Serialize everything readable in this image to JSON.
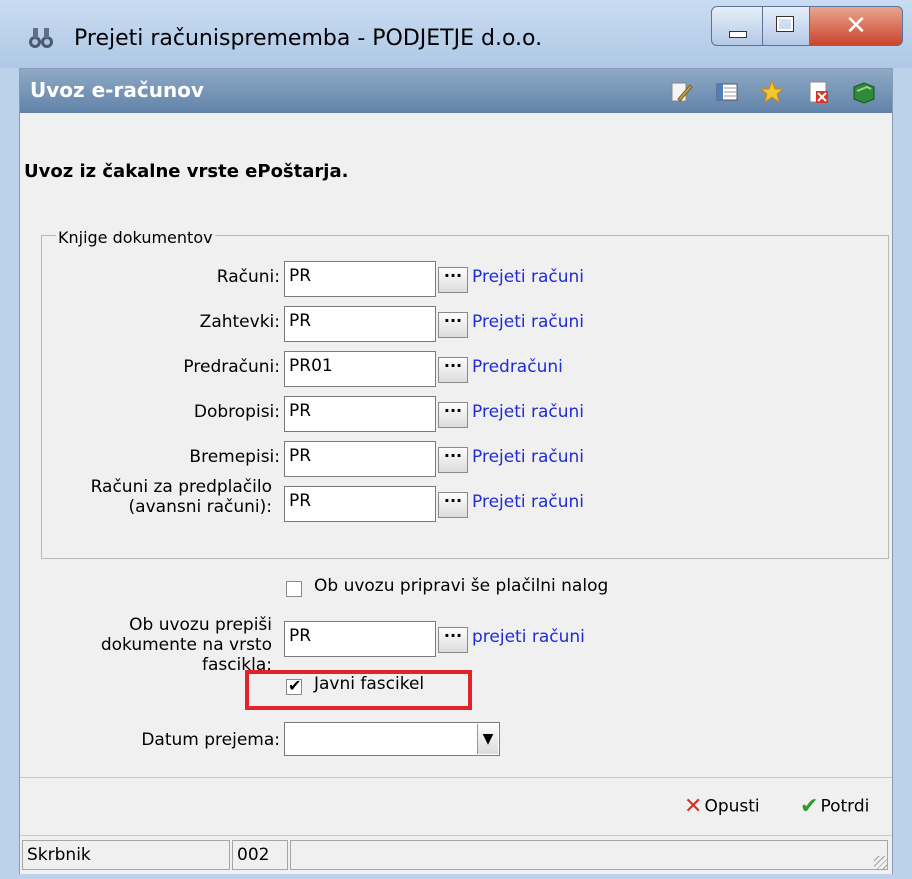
{
  "window": {
    "title": "Prejeti računisprememba - PODJETJE d.o.o.",
    "controls": {
      "minimize": "minimize",
      "maximize": "maximize",
      "close": "close"
    }
  },
  "header": {
    "title": "Uvoz e-računov",
    "icons": [
      "edit-icon",
      "columns-icon",
      "star-icon",
      "delete-doc-icon",
      "book-icon"
    ]
  },
  "intro": "Uvoz iz čakalne vrste ePoštarja.",
  "group": {
    "legend": "Knjige dokumentov",
    "rows": [
      {
        "label": "Računi:",
        "value": "PR",
        "link": "Prejeti računi"
      },
      {
        "label": "Zahtevki:",
        "value": "PR",
        "link": "Prejeti računi"
      },
      {
        "label": "Predračuni:",
        "value": "PR01",
        "link": "Predračuni"
      },
      {
        "label": "Dobropisi:",
        "value": "PR",
        "link": "Prejeti računi"
      },
      {
        "label": "Bremepisi:",
        "value": "PR",
        "link": "Prejeti računi"
      },
      {
        "label": "Računi za predplačilo (avansni računi):",
        "value": "PR",
        "link": "Prejeti računi"
      }
    ]
  },
  "payment_order": {
    "label": "Ob uvozu pripravi še plačilni nalog",
    "checked": false
  },
  "folder": {
    "label": "Ob uvozu prepiši dokumente na vrsto fascikla:",
    "value": "PR",
    "link": "prejeti računi"
  },
  "public_folder": {
    "label": "Javni fascikel",
    "checked": true,
    "highlight_color": "#e3232c"
  },
  "receipt_date": {
    "label": "Datum prejema:",
    "value": ""
  },
  "buttons": {
    "cancel": "Opusti",
    "confirm": "Potrdi"
  },
  "status": {
    "user": "Skrbnik",
    "code": "002"
  },
  "colors": {
    "link": "#1f2bd6",
    "header_bg": "#6f8fb3",
    "highlight": "#e3232c"
  }
}
